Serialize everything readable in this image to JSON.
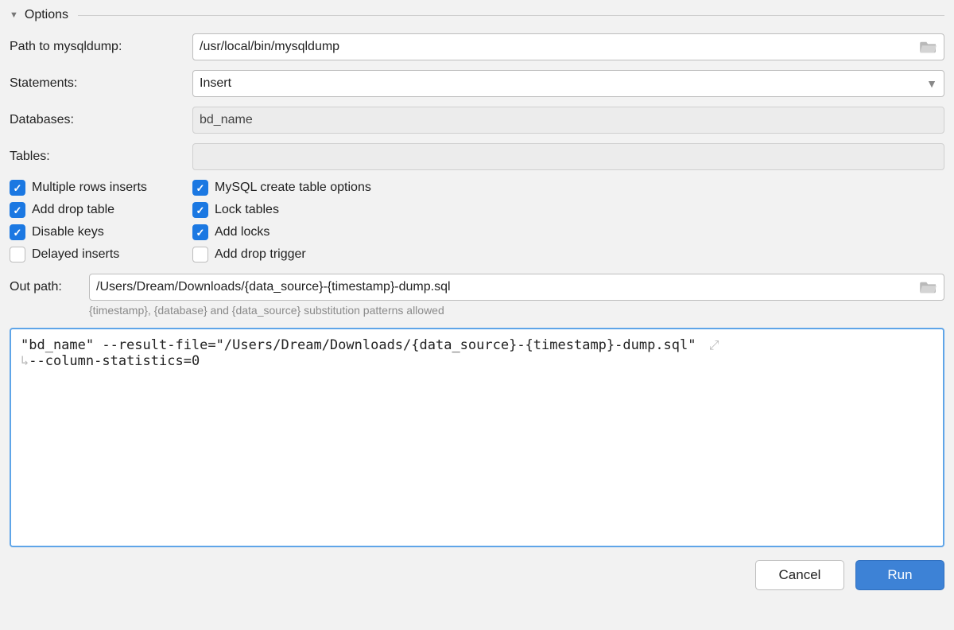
{
  "section_title": "Options",
  "labels": {
    "path_to_mysqldump": "Path to mysqldump:",
    "statements": "Statements:",
    "databases": "Databases:",
    "tables": "Tables:",
    "out_path": "Out path:"
  },
  "fields": {
    "mysqldump_path": "/usr/local/bin/mysqldump",
    "statements_selected": "Insert",
    "databases_value": "bd_name",
    "tables_value": "",
    "out_path_value": "/Users/Dream/Downloads/{data_source}-{timestamp}-dump.sql"
  },
  "checks": {
    "multiple_rows_inserts": {
      "label": "Multiple rows inserts",
      "checked": true
    },
    "mysql_create_table": {
      "label": "MySQL create table options",
      "checked": true
    },
    "add_drop_table": {
      "label": "Add drop table",
      "checked": true
    },
    "lock_tables": {
      "label": "Lock tables",
      "checked": true
    },
    "disable_keys": {
      "label": "Disable keys",
      "checked": true
    },
    "add_locks": {
      "label": "Add locks",
      "checked": true
    },
    "delayed_inserts": {
      "label": "Delayed inserts",
      "checked": false
    },
    "add_drop_trigger": {
      "label": "Add drop trigger",
      "checked": false
    }
  },
  "hint": "{timestamp}, {database} and {data_source} substitution patterns allowed",
  "command": {
    "line1": "\"bd_name\" --result-file=\"/Users/Dream/Downloads/{data_source}-{timestamp}-dump.sql\"",
    "line2": "--column-statistics=0"
  },
  "buttons": {
    "cancel": "Cancel",
    "run": "Run"
  }
}
